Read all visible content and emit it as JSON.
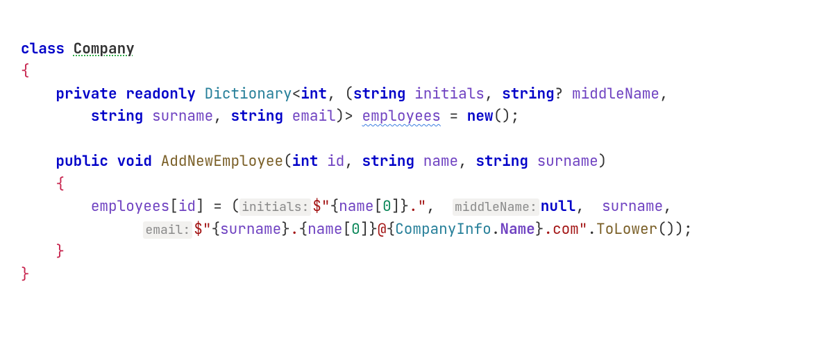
{
  "code": {
    "l1": {
      "kw_class": "class",
      "name": "Company"
    },
    "l2": {
      "brace": "{"
    },
    "l3": {
      "indent": "    ",
      "kw_private": "private",
      "kw_readonly": "readonly",
      "type_dict": "Dictionary",
      "lt": "<",
      "kw_int": "int",
      "comma1": ",",
      "lparen": "(",
      "kw_string1": "string",
      "id_initials": "initials",
      "comma2": ",",
      "kw_string2": "string",
      "q": "?",
      "id_middle": "middleName",
      "comma3": ","
    },
    "l4": {
      "indent": "        ",
      "kw_string3": "string",
      "id_surname": "surname",
      "comma4": ",",
      "kw_string4": "string",
      "id_email": "email",
      "rparen": ")",
      "gt": ">",
      "id_employees": "employees",
      "eq": "=",
      "kw_new": "new",
      "lp2": "(",
      "rp2": ")",
      "semi": ";"
    },
    "l6": {
      "indent": "    ",
      "kw_public": "public",
      "kw_void": "void",
      "method": "AddNewEmployee",
      "lp": "(",
      "kw_int": "int",
      "id": "id",
      "c1": ",",
      "kw_string1": "string",
      "name": "name",
      "c2": ",",
      "kw_string2": "string",
      "surname": "surname",
      "rp": ")"
    },
    "l7": {
      "indent": "    ",
      "brace": "{"
    },
    "l8": {
      "indent": "        ",
      "employees": "employees",
      "lb": "[",
      "id": "id",
      "rb": "]",
      "eq": "=",
      "lp": "(",
      "hint_initials": "initials:",
      "dollar1": "$",
      "q1a": "\"",
      "lbrace1": "{",
      "name1": "name",
      "lb2": "[",
      "zero": "0",
      "rb2": "]",
      "rbrace1": "}",
      "dot": ".",
      "q1b": "\"",
      "c1": ",",
      "hint_middle": "middleName:",
      "null": "null",
      "c2": ",",
      "surname": "surname",
      "c3": ","
    },
    "l9": {
      "indent": "            ",
      "hint_email": "email:",
      "dollar": "$",
      "q2a": "\"",
      "lbrace2": "{",
      "surname2": "surname",
      "rbrace2": "}",
      "dot2": ".",
      "lbrace3": "{",
      "name2": "name",
      "lb3": "[",
      "zero2": "0",
      "rb3": "]",
      "rbrace3": "}",
      "at": "@",
      "lbrace4": "{",
      "companyinfo": "CompanyInfo",
      "dot3": ".",
      "nameprop": "Name",
      "rbrace4": "}",
      "dotcom": ".com",
      "q2b": "\"",
      "dot4": ".",
      "tolower": "ToLower",
      "lp2": "(",
      "rp2": ")",
      "rp": ")",
      "semi": ";"
    },
    "l10": {
      "indent": "    ",
      "brace": "}"
    },
    "l11": {
      "brace": "}"
    }
  }
}
